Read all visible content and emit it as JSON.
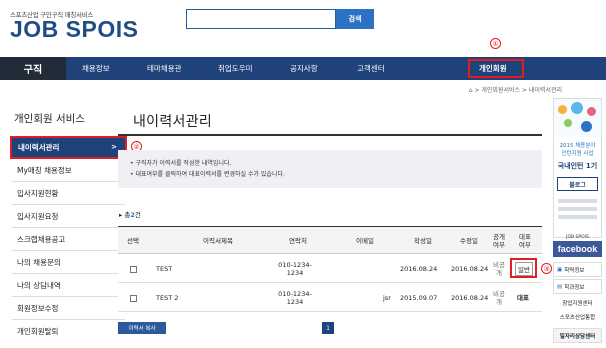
{
  "header": {
    "logo_sub": "스포츠산업 구인구직 매칭서비스",
    "logo": "JOB SPOIS",
    "search_button": "검색"
  },
  "nav": {
    "main": "구직",
    "items": [
      "채용정보",
      "테마채용관",
      "취업도우미",
      "공지사항",
      "고객센터",
      "개인회원"
    ]
  },
  "callouts": [
    "①",
    "②",
    "③"
  ],
  "breadcrumb": "⌂  >  개인회원서비스  >  내이력서관리",
  "sidebar": {
    "title": "개인회원 서비스",
    "active": "내이력서관리",
    "active_arrow": ">",
    "items": [
      "My매칭 채용정보",
      "입사지원현황",
      "입사지원요청",
      "스크랩채용공고",
      "나의 채용문의",
      "나의 상담내역",
      "회원정보수정",
      "개인회원탈퇴"
    ]
  },
  "main": {
    "title": "내이력서관리",
    "notices": [
      "• 구직자가 이력서를 작성한 내역입니다.",
      "• 대표여부를 클릭하여 대표이력서를 변경하실 수가 있습니다."
    ],
    "count_prefix": "▸ 총",
    "count_value": "2",
    "count_suffix": "건",
    "columns": [
      "선택",
      "이력서제목",
      "연락처",
      "이메일",
      "작성일",
      "수정일",
      "공개\n여부",
      "대표\n여부"
    ],
    "rows": [
      {
        "title": "TEST",
        "phone": "010-1234-\n1234",
        "email": "",
        "created": "2016.08.24",
        "modified": "2016.08.24",
        "public": "비공\n개",
        "rep": "일반"
      },
      {
        "title": "TEST 2",
        "phone": "010-1234-\n1234",
        "email": "jsr",
        "created": "2015.09.07",
        "modified": "2016.08.24",
        "public": "비공\n개",
        "rep": "대표"
      }
    ],
    "copy_button": "이력서 복사",
    "page": "1"
  },
  "right_rail": {
    "banner_line1": "2015 채용분야",
    "banner_line2": "인턴지원 사업",
    "banner_main": "국내인턴 1기",
    "banner_btn": "블로그",
    "fb_top": "JOB SPOIS",
    "facebook": "facebook",
    "links": [
      "학력정보",
      "학과정보",
      "창업지원센터",
      "스포츠산업통합",
      "일자리상담센터"
    ]
  },
  "colors": {
    "nav": "#1e4279",
    "nav_dark": "#222b38",
    "accent": "#2c72c4",
    "highlight": "#e31b23"
  }
}
